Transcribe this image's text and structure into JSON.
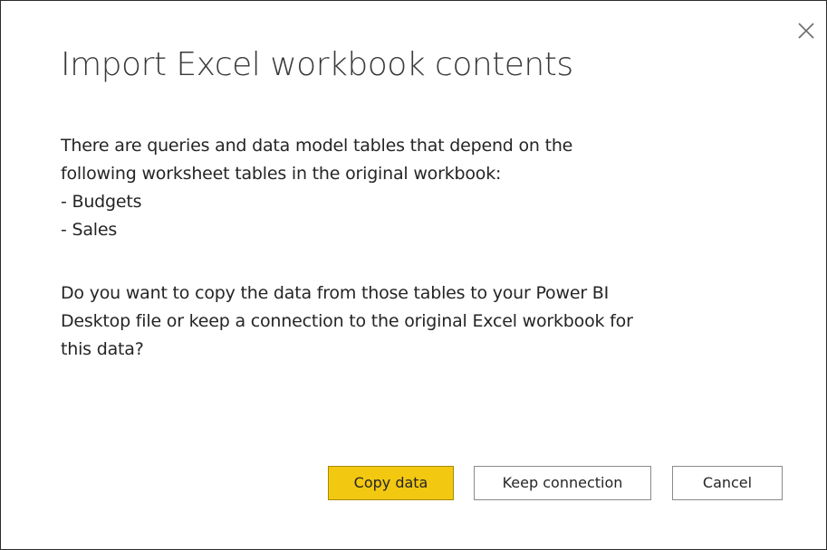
{
  "dialog": {
    "title": "Import Excel workbook contents",
    "close_icon": "close-icon",
    "message_intro_line1": "There are queries and data model tables that depend on the",
    "message_intro_line2": "following worksheet tables in the original workbook:",
    "tables": [
      "- Budgets",
      "- Sales"
    ],
    "question_line1": "Do you want to copy the data from those tables to your Power BI",
    "question_line2": "Desktop file or keep a connection to the original Excel workbook for",
    "question_line3": "this data?",
    "buttons": {
      "copy_label": "Copy data",
      "keep_label": "Keep connection",
      "cancel_label": "Cancel"
    }
  },
  "colors": {
    "primary_button": "#f2c811",
    "border": "#2b2b2b",
    "text": "#252525"
  }
}
